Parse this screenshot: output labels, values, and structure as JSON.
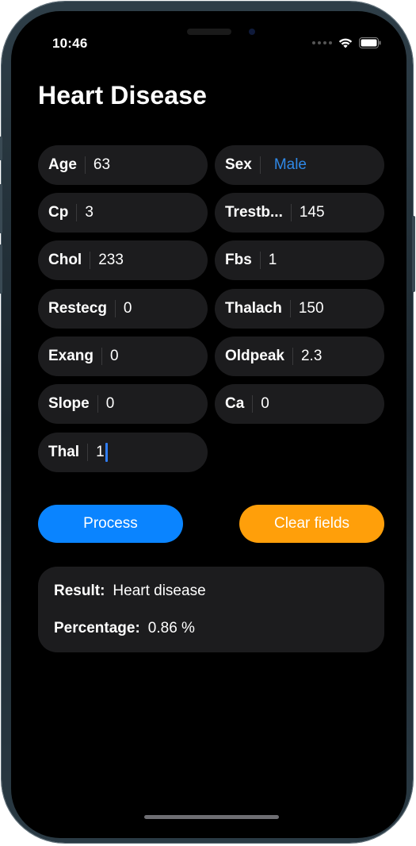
{
  "status_bar": {
    "time": "10:46",
    "icons": [
      "cellular-dots-icon",
      "wifi-icon",
      "battery-icon"
    ]
  },
  "title": "Heart Disease",
  "fields": [
    {
      "label": "Age",
      "value": "63"
    },
    {
      "label": "Sex",
      "value": "Male"
    },
    {
      "label": "Cp",
      "value": "3"
    },
    {
      "label": "Trestb...",
      "value": "145"
    },
    {
      "label": "Chol",
      "value": "233"
    },
    {
      "label": "Fbs",
      "value": "1"
    },
    {
      "label": "Restecg",
      "value": "0"
    },
    {
      "label": "Thalach",
      "value": "150"
    },
    {
      "label": "Exang",
      "value": "0"
    },
    {
      "label": "Oldpeak",
      "value": "2.3"
    },
    {
      "label": "Slope",
      "value": "0"
    },
    {
      "label": "Ca",
      "value": "0"
    },
    {
      "label": "Thal",
      "value": "1"
    }
  ],
  "buttons": {
    "process": "Process",
    "clear": "Clear fields"
  },
  "result": {
    "result_label": "Result:",
    "result_value": "Heart disease",
    "percentage_label": "Percentage:",
    "percentage_value": "0.86 %"
  },
  "colors": {
    "accent_blue": "#0a84ff",
    "accent_orange": "#ff9f0a",
    "link_blue": "#2f88e6",
    "card_background": "#1c1c1e"
  }
}
